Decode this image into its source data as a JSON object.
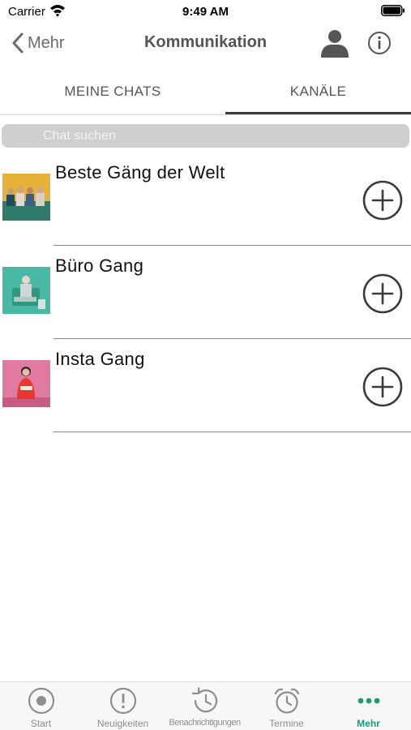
{
  "status_bar": {
    "carrier": "Carrier",
    "time": "9:49 AM"
  },
  "nav": {
    "back_label": "Mehr",
    "title": "Kommunikation",
    "profile_icon": "person-icon",
    "info_icon": "info-icon"
  },
  "tabs": [
    {
      "label": "MEINE CHATS",
      "selected": false
    },
    {
      "label": "KANÄLE",
      "selected": true
    }
  ],
  "search": {
    "placeholder": "Chat suchen",
    "value": ""
  },
  "channels": [
    {
      "name": "Beste Gäng der Welt",
      "action_icon": "plus-circle-icon"
    },
    {
      "name": "Büro Gang",
      "action_icon": "plus-circle-icon"
    },
    {
      "name": "Insta Gang",
      "action_icon": "plus-circle-icon"
    }
  ],
  "tab_bar": {
    "items": [
      {
        "label": "Start",
        "icon": "record-icon",
        "active": false
      },
      {
        "label": "Neuigkeiten",
        "icon": "exclamation-circle-icon",
        "active": false
      },
      {
        "label": "Benachrichtigungen",
        "icon": "history-icon",
        "active": false
      },
      {
        "label": "Termine",
        "icon": "alarm-clock-icon",
        "active": false
      },
      {
        "label": "Mehr",
        "icon": "more-dots-icon",
        "active": true
      }
    ]
  },
  "colors": {
    "accent": "#1a9a78",
    "inactive": "#8e8e8e",
    "search_background": "#cfcfcf"
  }
}
